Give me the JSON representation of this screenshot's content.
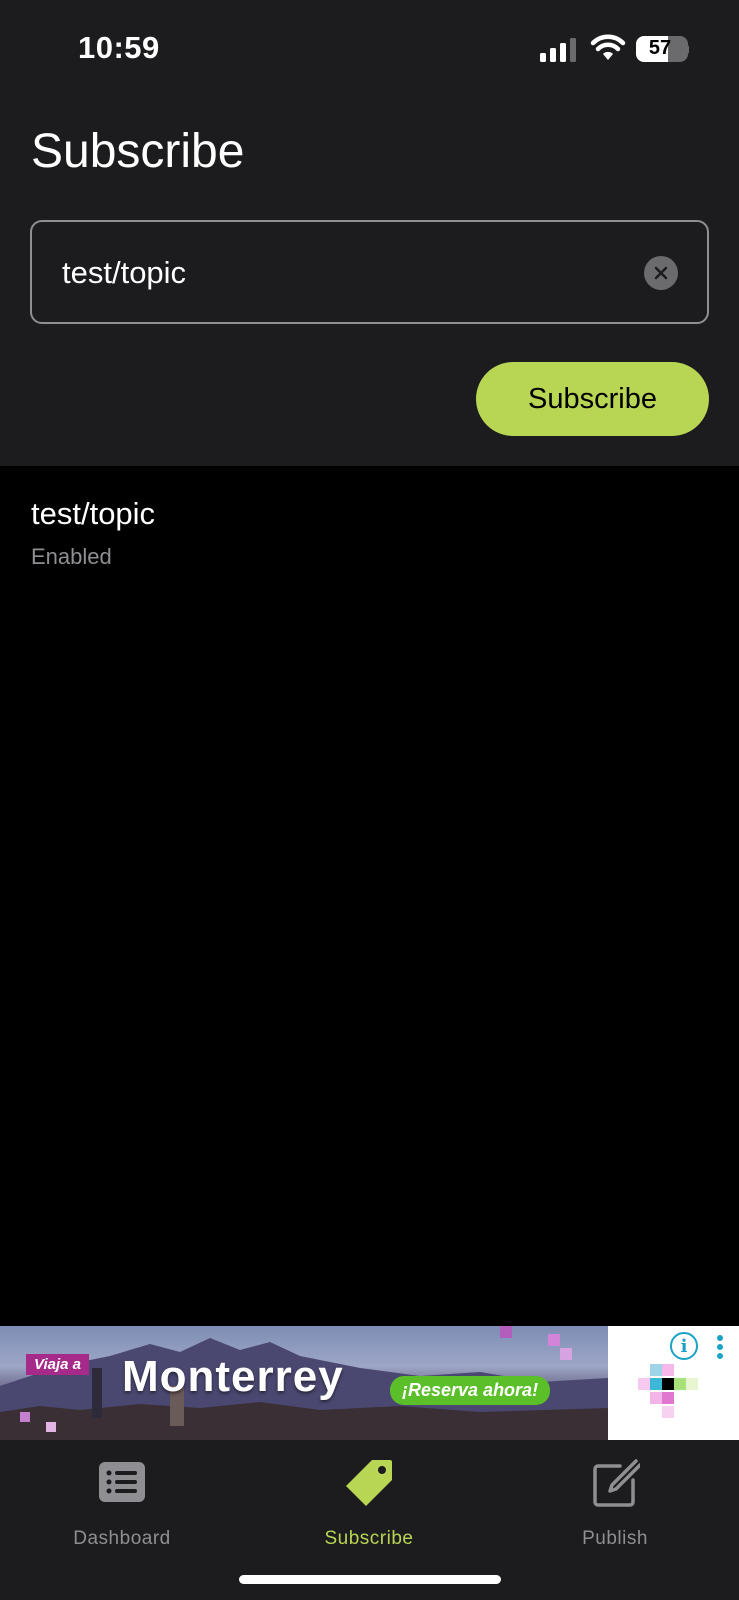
{
  "status_bar": {
    "time": "10:59",
    "battery_percent": "57"
  },
  "header": {
    "title": "Subscribe"
  },
  "topic_field": {
    "value": "test/topic",
    "clear_icon": "x-circle-icon"
  },
  "subscribe_button": {
    "label": "Subscribe"
  },
  "subscriptions": [
    {
      "topic": "test/topic",
      "status": "Enabled"
    }
  ],
  "ad": {
    "kicker": "Viaja a",
    "title": "Monterrey",
    "cta": "¡Reserva ahora!"
  },
  "tabs": [
    {
      "label": "Dashboard",
      "icon": "list-icon",
      "active": false
    },
    {
      "label": "Subscribe",
      "icon": "tag-icon",
      "active": true
    },
    {
      "label": "Publish",
      "icon": "compose-icon",
      "active": false
    }
  ],
  "colors": {
    "accent": "#b8d554",
    "surface": "#1c1c1e",
    "background": "#000000",
    "muted_text": "#8e8e93"
  }
}
